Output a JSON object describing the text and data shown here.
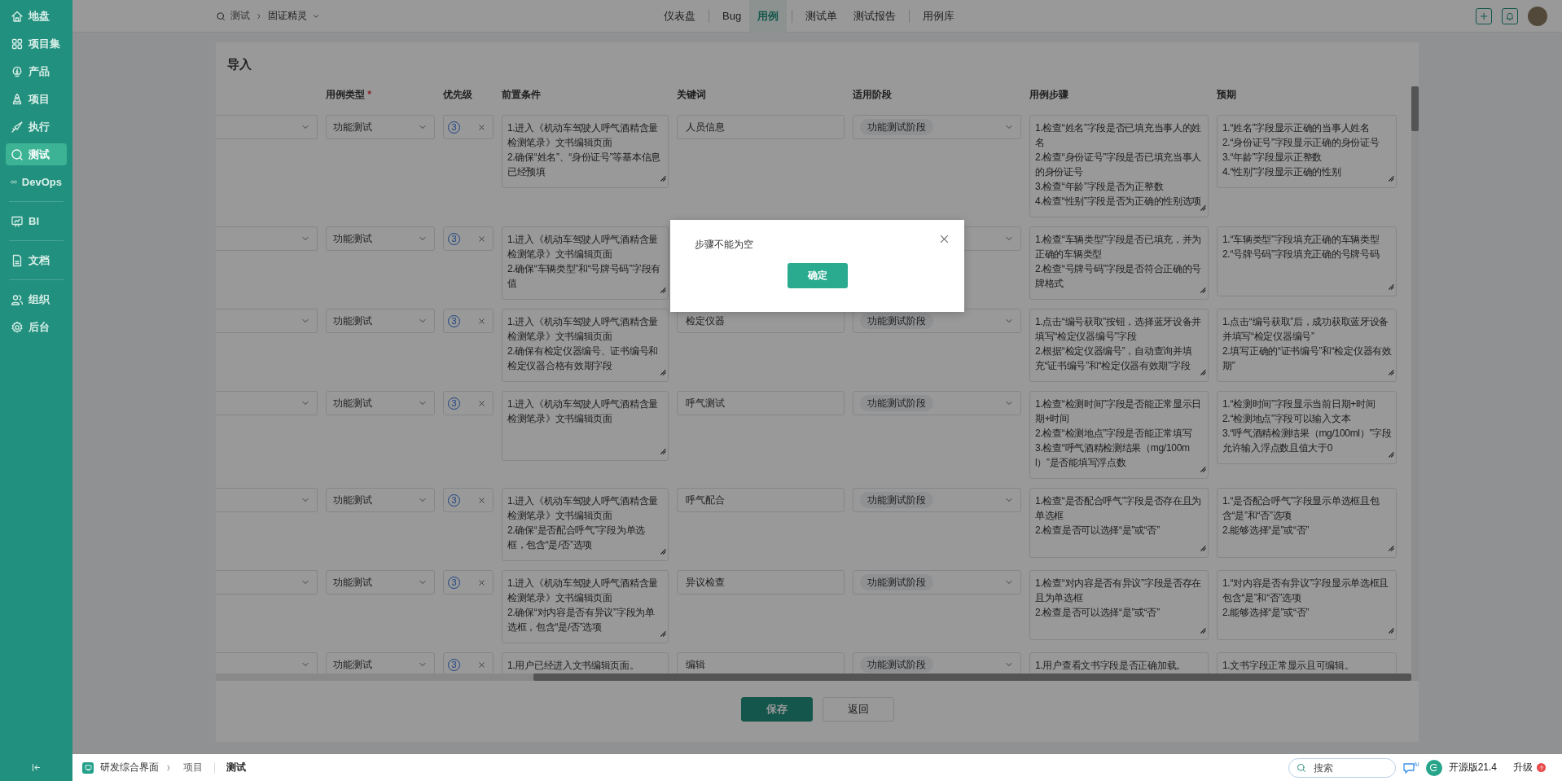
{
  "sidebar": {
    "groups": [
      [
        {
          "label": "地盘",
          "selected": false
        },
        {
          "label": "项目集",
          "selected": false
        },
        {
          "label": "产品",
          "selected": false
        },
        {
          "label": "项目",
          "selected": false
        },
        {
          "label": "执行",
          "selected": false
        },
        {
          "label": "测试",
          "selected": true
        },
        {
          "label": "DevOps",
          "selected": false
        }
      ],
      [
        {
          "label": "BI",
          "selected": false
        }
      ],
      [
        {
          "label": "文档",
          "selected": false
        }
      ],
      [
        {
          "label": "组织",
          "selected": false
        },
        {
          "label": "后台",
          "selected": false
        }
      ]
    ]
  },
  "top_bar": {
    "breadcrumb": {
      "module": "测试",
      "project": "固证精灵"
    },
    "nav": [
      [
        {
          "label": "仪表盘",
          "selected": false
        }
      ],
      [
        {
          "label": "Bug",
          "selected": false
        },
        {
          "label": "用例",
          "selected": true
        }
      ],
      [
        {
          "label": "测试单",
          "selected": false
        },
        {
          "label": "测试报告",
          "selected": false
        }
      ],
      [
        {
          "label": "用例库",
          "selected": false
        }
      ]
    ]
  },
  "panel": {
    "title": "导入",
    "table": {
      "columns": [
        {
          "label": "用例类型",
          "required_mark": "*"
        },
        {
          "label": "优先级"
        },
        {
          "label": "前置条件"
        },
        {
          "label": "关键词"
        },
        {
          "label": "适用阶段"
        },
        {
          "label": "用例步骤"
        },
        {
          "label": "预期"
        }
      ],
      "rows": [
        {
          "type": "功能测试",
          "priority": "3",
          "precondition": "1.进入《机动车驾驶人呼气酒精含量检测笔录》文书编辑页面\n2.确保“姓名”、“身份证号”等基本信息已经预填",
          "keyword": "人员信息",
          "stage": "功能测试阶段",
          "steps": "1.检查“姓名”字段是否已填充当事人的姓名\n2.检查“身份证号”字段是否已填充当事人的身份证号\n3.检查“年龄”字段是否为正整数\n4.检查“性别”字段是否为正确的性别选项",
          "expected": "1.“姓名”字段显示正确的当事人姓名\n2.“身份证号”字段显示正确的身份证号\n3.“年龄”字段显示正整数\n4.“性别”字段显示正确的性别"
        },
        {
          "type": "功能测试",
          "priority": "3",
          "precondition": "1.进入《机动车驾驶人呼气酒精含量检测笔录》文书编辑页面\n2.确保“车辆类型”和“号牌号码”字段有值",
          "steps": "1.检查“车辆类型”字段是否已填充，并为正确的车辆类型\n2.检查“号牌号码”字段是否符合正确的号牌格式",
          "expected": "1.“车辆类型”字段填充正确的车辆类型\n2.“号牌号码”字段填充正确的号牌号码"
        },
        {
          "type": "功能测试",
          "priority": "3",
          "precondition": "1.进入《机动车驾驶人呼气酒精含量检测笔录》文书编辑页面\n2.确保有检定仪器编号、证书编号和检定仪器合格有效期字段",
          "keyword": "检定仪器",
          "stage": "功能测试阶段",
          "steps": "1.点击“编号获取”按钮，选择蓝牙设备并填写“检定仪器编号”字段\n2.根据“检定仪器编号”，自动查询并填充“证书编号”和“检定仪器有效期”字段",
          "expected": "1.点击“编号获取”后，成功获取蓝牙设备并填写“检定仪器编号”\n2.填写正确的“证书编号”和“检定仪器有效期”"
        },
        {
          "type": "功能测试",
          "priority": "3",
          "precondition": "1.进入《机动车驾驶人呼气酒精含量检测笔录》文书编辑页面",
          "keyword": "呼气测试",
          "stage": "功能测试阶段",
          "steps": "1.检查“检测时间”字段是否能正常显示日期+时间\n2.检查“检测地点”字段是否能正常填写\n3.检查“呼气酒精检测结果（mg/100ml）”是否能填写浮点数",
          "expected": "1.“检测时间”字段显示当前日期+时间\n2.“检测地点”字段可以输入文本\n3.“呼气酒精检测结果（mg/100ml）”字段允许输入浮点数且值大于0"
        },
        {
          "type": "功能测试",
          "priority": "3",
          "precondition": "1.进入《机动车驾驶人呼气酒精含量检测笔录》文书编辑页面\n2.确保“是否配合呼气”字段为单选框，包含“是/否”选项",
          "keyword": "呼气配合",
          "stage": "功能测试阶段",
          "steps": "1.检查“是否配合呼气”字段是否存在且为单选框\n2.检查是否可以选择“是”或“否”",
          "expected": "1.“是否配合呼气”字段显示单选框且包含“是”和“否”选项\n2.能够选择“是”或“否”"
        },
        {
          "type": "功能测试",
          "priority": "3",
          "precondition": "1.进入《机动车驾驶人呼气酒精含量检测笔录》文书编辑页面\n2.确保“对内容是否有异议”字段为单选框，包含“是/否”选项",
          "keyword": "异议检查",
          "stage": "功能测试阶段",
          "steps": "1.检查“对内容是否有异议”字段是否存在且为单选框\n2.检查是否可以选择“是”或“否”",
          "expected": "1.“对内容是否有异议”字段显示单选框且包含“是”和“否”选项\n2.能够选择“是”或“否”"
        },
        {
          "type": "功能测试",
          "priority": "3",
          "precondition": "1.用户已经进入文书编辑页面。",
          "keyword": "编辑",
          "stage": "功能测试阶段",
          "steps": "1.用户查看文书字段是否正确加载。",
          "expected": "1.文书字段正常显示且可编辑。"
        }
      ]
    },
    "buttons": [
      {
        "label": "保存",
        "kind": "primary"
      },
      {
        "label": "返回",
        "kind": "default"
      }
    ]
  },
  "dialog": {
    "message": "步骤不能为空",
    "confirm": "确定"
  },
  "status_bar": {
    "app": "研发综合界面",
    "crumbs": [
      {
        "label": "项目",
        "selected": false
      },
      {
        "label": "测试",
        "selected": true
      }
    ],
    "search": {
      "placeholder": "搜索"
    },
    "ai_badge": "AI",
    "edition": "开源版21.4",
    "upgrade": "升级"
  }
}
